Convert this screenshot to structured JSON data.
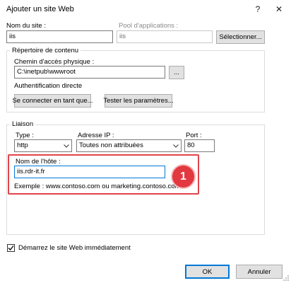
{
  "window": {
    "title": "Ajouter un site Web"
  },
  "titlebar": {
    "help": "?",
    "close": "✕"
  },
  "site": {
    "name_label": "Nom du site :",
    "name_value": "iis",
    "pool_label": "Pool d'applications :",
    "pool_value": "iis",
    "select_button": "Sélectionner..."
  },
  "content_dir": {
    "group_title": "Répertoire de contenu",
    "path_label": "Chemin d'accès physique :",
    "path_value": "C:\\inetpub\\wwwroot",
    "browse_button": "...",
    "auth_label": "Authentification directe",
    "connect_button": "Se connecter en tant que...",
    "test_button": "Tester les paramètres..."
  },
  "binding": {
    "group_title": "Liaison",
    "type_label": "Type :",
    "type_value": "http",
    "ip_label": "Adresse IP :",
    "ip_value": "Toutes non attribuées",
    "port_label": "Port :",
    "port_value": "80",
    "host_label": "Nom de l'hôte :",
    "host_value": "iis.rdr-it.fr",
    "example": "Exemple : www.contoso.com ou marketing.contoso.com"
  },
  "annotation": {
    "number": "1",
    "color": "#e2383f"
  },
  "start": {
    "label": "Démarrez le site Web immédiatement",
    "checked": true
  },
  "footer": {
    "ok": "OK",
    "cancel": "Annuler"
  },
  "colors": {
    "accent": "#0078d7",
    "highlight": "#e0454a"
  }
}
